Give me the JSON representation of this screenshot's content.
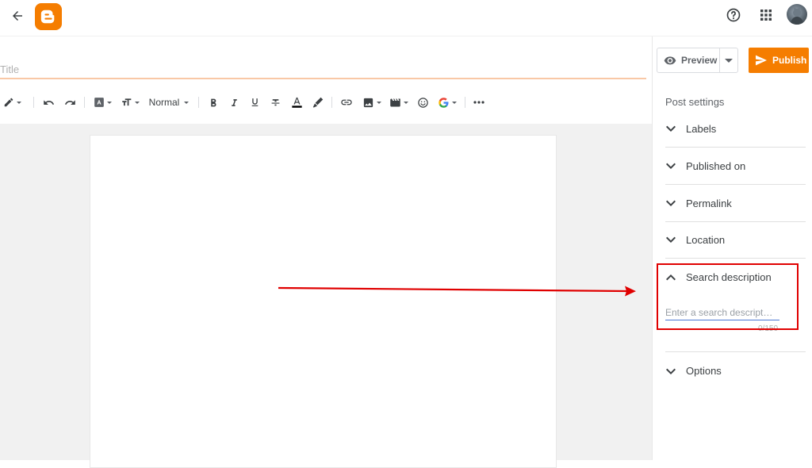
{
  "colors": {
    "accent": "#f57d00",
    "highlight": "#e00000",
    "input_underline": "#4a77d4"
  },
  "header": {
    "back_icon": "arrow-left-icon",
    "logo_icon": "blogger-logo-icon",
    "help_icon": "help-circle-icon",
    "apps_icon": "apps-grid-icon",
    "avatar": "user-avatar"
  },
  "editor": {
    "title_placeholder": "Title",
    "toolbar": {
      "format_label": "Normal",
      "icons": [
        "pencil-icon",
        "undo-icon",
        "redo-icon",
        "font-icon",
        "text-size-icon",
        "bold-icon",
        "italic-icon",
        "underline-icon",
        "strikethrough-icon",
        "text-color-icon",
        "highlight-icon",
        "link-icon",
        "image-icon",
        "video-icon",
        "emoji-icon",
        "google-icon",
        "more-icon"
      ]
    }
  },
  "actions": {
    "preview_label": "Preview",
    "publish_label": "Publish"
  },
  "sidebar": {
    "title": "Post settings",
    "sections": [
      {
        "label": "Labels"
      },
      {
        "label": "Published on"
      },
      {
        "label": "Permalink"
      },
      {
        "label": "Location"
      },
      {
        "label": "Search description"
      },
      {
        "label": "Options"
      }
    ],
    "search_description": {
      "placeholder": "Enter a search descript…",
      "counter": "0/150"
    }
  }
}
